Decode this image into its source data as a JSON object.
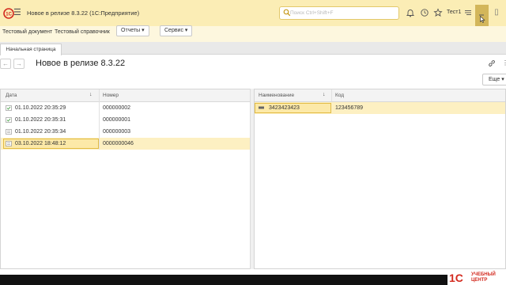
{
  "titlebar": {
    "title": "Новое в релизе 8.3.22  (1С:Предприятие)",
    "search_placeholder": "Поиск Ctrl+Shift+F",
    "user": "Тест1",
    "accent_color": "#fbedb5"
  },
  "menubar": {
    "items": [
      "Тестовый документ",
      "Тестовый справочник"
    ],
    "buttons": [
      "Отчеты ▾",
      "Сервис ▾"
    ]
  },
  "tabs": [
    "Начальная страница"
  ],
  "page": {
    "title": "Новое в релизе 8.3.22",
    "more_label": "Еще ▾"
  },
  "left_table": {
    "columns": [
      "Дата",
      "Номер"
    ],
    "rows": [
      {
        "date": "01.10.2022 20:35:29",
        "number": "000000002",
        "icon": "document-posted-icon"
      },
      {
        "date": "01.10.2022 20:35:31",
        "number": "000000001",
        "icon": "document-posted-icon"
      },
      {
        "date": "01.10.2022 20:35:34",
        "number": "000000003",
        "icon": "document-icon"
      },
      {
        "date": "03.10.2022 18:48:12",
        "number": "0000000046",
        "icon": "document-icon",
        "selected": true
      }
    ]
  },
  "right_table": {
    "columns": [
      "Наименование",
      "Код"
    ],
    "rows": [
      {
        "name": "3423423423",
        "code": "123456789",
        "icon": "catalog-item-icon",
        "selected": true
      }
    ]
  },
  "watermark": {
    "text": "УЧЕБНЫЙ ЦЕНТР"
  }
}
